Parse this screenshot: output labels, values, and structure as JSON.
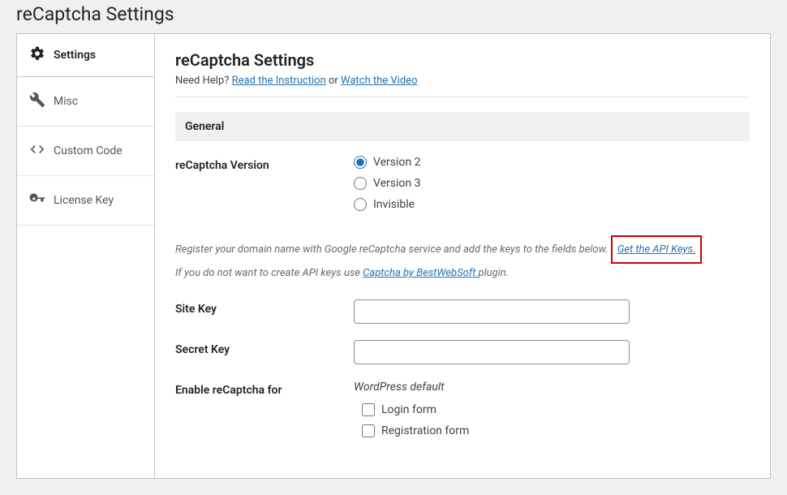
{
  "page_title": "reCaptcha Settings",
  "sidebar": {
    "items": [
      {
        "label": "Settings",
        "icon": "gear"
      },
      {
        "label": "Misc",
        "icon": "wrench"
      },
      {
        "label": "Custom Code",
        "icon": "code"
      },
      {
        "label": "License Key",
        "icon": "key"
      }
    ]
  },
  "main": {
    "heading": "reCaptcha Settings",
    "help_prefix": "Need Help? ",
    "help_link1": "Read the Instruction",
    "help_or": " or ",
    "help_link2": "Watch the Video",
    "section_general": "General",
    "version_label": "reCaptcha Version",
    "versions": {
      "v2": "Version 2",
      "v3": "Version 3",
      "invisible": "Invisible"
    },
    "info_line1_a": "Register your domain name with Google reCaptcha service and add the keys to the fields below. ",
    "info_link1": "Get the API Keys.",
    "info_line2_a": "If you do not want to create API keys use ",
    "info_link2": "Captcha by BestWebSoft ",
    "info_line2_b": "plugin.",
    "site_key_label": "Site Key",
    "secret_key_label": "Secret Key",
    "enable_label": "Enable reCaptcha for",
    "wp_default": "WordPress default",
    "checkboxes": {
      "login": "Login form",
      "registration": "Registration form"
    }
  }
}
